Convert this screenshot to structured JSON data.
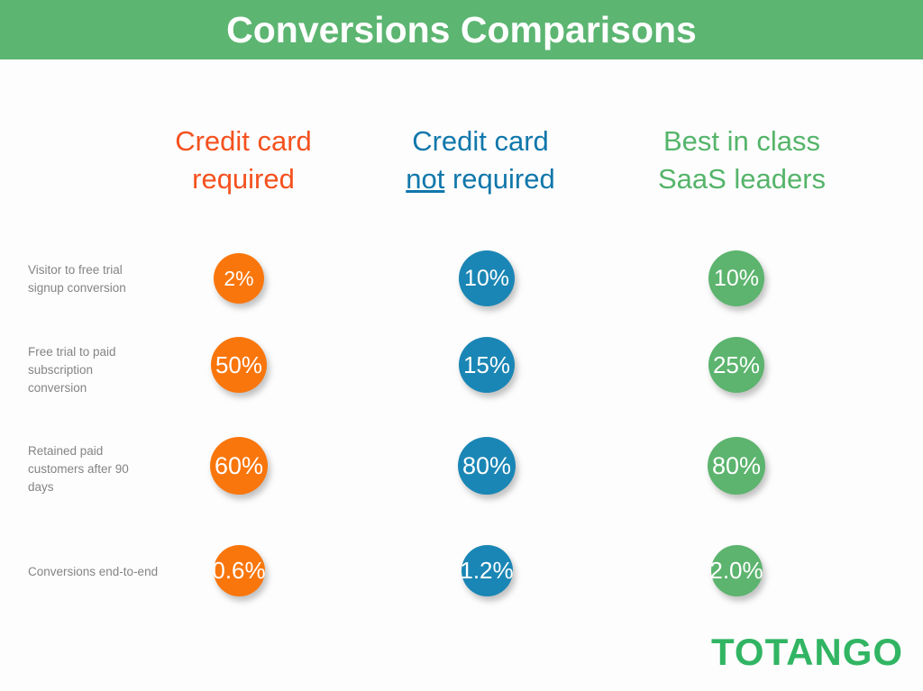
{
  "title": "Conversions Comparisons",
  "colors": {
    "banner_green": "#5cb571",
    "orange": "#f9760c",
    "blue": "#1a86b5",
    "green": "#5cb46e",
    "header_orange": "#f4511e",
    "header_blue": "#1077ab",
    "header_green": "#55b46a",
    "label_gray": "#848484",
    "logo_green": "#31b563",
    "background": "#fdfdfd"
  },
  "columns": [
    {
      "id": "credit-card-required",
      "line1": "Credit card",
      "line2_pre": "",
      "line2_underline": "",
      "line2_post": "required",
      "color": "#f4511e"
    },
    {
      "id": "credit-card-not-required",
      "line1": "Credit card",
      "line2_pre": "",
      "line2_underline": "not",
      "line2_post": " required",
      "color": "#1077ab"
    },
    {
      "id": "best-in-class-saas-leaders",
      "line1": "Best in class",
      "line2_pre": "",
      "line2_underline": "",
      "line2_post": "SaaS leaders",
      "color": "#55b46a"
    }
  ],
  "rows": [
    {
      "id": "visitor-to-free-trial-signup-conversion",
      "label_lines": [
        "Visitor to free trial",
        "signup conversion"
      ],
      "cells": [
        {
          "value": "2%",
          "color": "#f9760c",
          "size": 56,
          "font": 23
        },
        {
          "value": "10%",
          "color": "#1a86b5",
          "size": 62,
          "font": 25
        },
        {
          "value": "10%",
          "color": "#5cb46e",
          "size": 62,
          "font": 25
        }
      ]
    },
    {
      "id": "free-trial-to-paid-subscription-conversion",
      "label_lines": [
        "Free trial to paid",
        "subscription",
        "conversion"
      ],
      "cells": [
        {
          "value": "50%",
          "color": "#f9760c",
          "size": 62,
          "font": 26
        },
        {
          "value": "15%",
          "color": "#1a86b5",
          "size": 62,
          "font": 26
        },
        {
          "value": "25%",
          "color": "#5cb46e",
          "size": 62,
          "font": 26
        }
      ]
    },
    {
      "id": "retained-paid-customers-after-90-days",
      "label_lines": [
        "Retained paid",
        "customers after 90",
        "days"
      ],
      "cells": [
        {
          "value": "60%",
          "color": "#f9760c",
          "size": 64,
          "font": 27
        },
        {
          "value": "80%",
          "color": "#1a86b5",
          "size": 64,
          "font": 27
        },
        {
          "value": "80%",
          "color": "#5cb46e",
          "size": 64,
          "font": 27
        }
      ]
    },
    {
      "id": "conversions-end-to-end",
      "label_lines": [
        "Conversions end-to-end"
      ],
      "cells": [
        {
          "value": "0.6%",
          "color": "#f9760c",
          "size": 57,
          "font": 26
        },
        {
          "value": "1.2%",
          "color": "#1a86b5",
          "size": 57,
          "font": 26
        },
        {
          "value": "2.0%",
          "color": "#5cb46e",
          "size": 57,
          "font": 26
        }
      ]
    }
  ],
  "logo": "TOTANGO",
  "chart_data": {
    "type": "table",
    "title": "Conversions Comparisons",
    "categories": [
      "Visitor to free trial signup conversion",
      "Free trial to paid subscription conversion",
      "Retained paid customers after 90 days",
      "Conversions end-to-end"
    ],
    "series": [
      {
        "name": "Credit card required",
        "values": [
          "2%",
          "50%",
          "60%",
          "0.6%"
        ],
        "color": "#f9760c"
      },
      {
        "name": "Credit card not required",
        "values": [
          "10%",
          "15%",
          "80%",
          "1.2%"
        ],
        "color": "#1a86b5"
      },
      {
        "name": "Best in class SaaS leaders",
        "values": [
          "10%",
          "25%",
          "80%",
          "2.0%"
        ],
        "color": "#5cb46e"
      }
    ],
    "legend": "column headers",
    "xlabel": "",
    "ylabel": ""
  },
  "layout": {
    "row_centers_y": [
      309,
      405,
      517,
      633
    ],
    "label_tops": [
      290,
      381,
      491,
      625
    ],
    "col_centers_x": [
      265,
      540,
      817
    ]
  }
}
